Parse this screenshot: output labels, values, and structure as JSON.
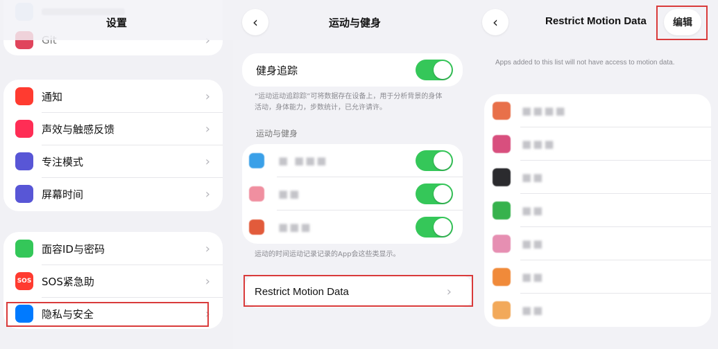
{
  "panel1": {
    "title": "设置",
    "top_item": "Git",
    "group1": [
      {
        "label": "通知",
        "icon": "bell-icon",
        "color": "#ff3b30"
      },
      {
        "label": "声效与触感反馈",
        "icon": "speaker-icon",
        "color": "#ff2d55"
      },
      {
        "label": "专注模式",
        "icon": "moon-icon",
        "color": "#5856d6"
      },
      {
        "label": "屏幕时间",
        "icon": "hourglass-icon",
        "color": "#5856d6"
      }
    ],
    "group2": [
      {
        "label": "面容ID与密码",
        "icon": "faceid-icon",
        "color": "#34c759"
      },
      {
        "label": "SOS紧急助",
        "icon": "sos-icon",
        "color": "#ff3b30",
        "icon_text": "SOS"
      },
      {
        "label": "隐私与安全",
        "icon": "hand-icon",
        "color": "#007aff"
      }
    ]
  },
  "panel2": {
    "title": "运动与健身",
    "fitness_tracking": {
      "label": "健身追踪",
      "on": true
    },
    "fitness_note": "“运动运动追踪踪”可将数据存在设备上，用于分析背景的身体活动，身体能力，步数统计，已允许请许。",
    "section_header": "运动与健身",
    "apps": [
      {
        "name": "■ ■■■",
        "on": true,
        "color": "#3aa0e8"
      },
      {
        "name": "■■",
        "on": true,
        "color": "#f08fa0"
      },
      {
        "name": "■■■",
        "on": true,
        "color": "#e25b3b"
      }
    ],
    "apps_note": "运动的时间运动记录记录的App会这些类显示。",
    "restrict_label": "Restrict Motion Data"
  },
  "panel3": {
    "title": "Restrict Motion Data",
    "edit_label": "编辑",
    "note": "Apps added to this list will not have access to motion data.",
    "apps": [
      {
        "name": "■■■■",
        "color": "#e8704a"
      },
      {
        "name": "■■■",
        "color": "#d84f7e"
      },
      {
        "name": "■■",
        "color": "#2b2b2e"
      },
      {
        "name": "■■",
        "color": "#37b24d"
      },
      {
        "name": "■■",
        "color": "#e68fb2"
      },
      {
        "name": "■■",
        "color": "#f08a3a"
      },
      {
        "name": "■■",
        "color": "#f2a95a"
      }
    ]
  },
  "colors": {
    "toggle_on": "#35c759",
    "highlight": "#d93a3a",
    "chevron": "#b5b5bb"
  }
}
